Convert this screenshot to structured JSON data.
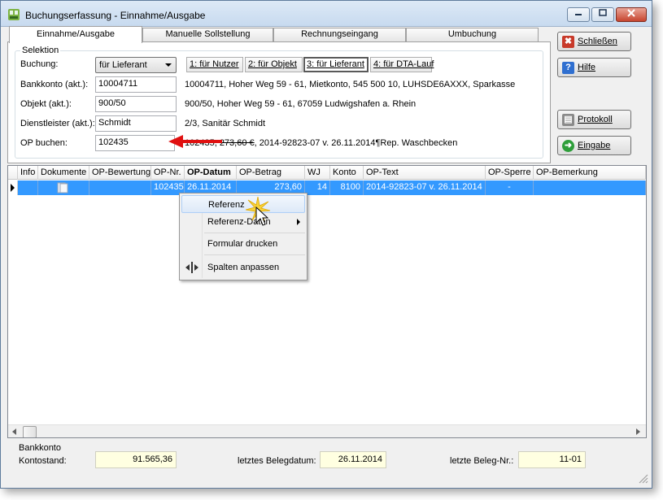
{
  "window": {
    "title": "Buchungserfassung - Einnahme/Ausgabe"
  },
  "tabs": [
    "Einnahme/Ausgabe",
    "Manuelle Sollstellung",
    "Rechnungseingang",
    "Umbuchung"
  ],
  "selektion": {
    "group_label": "Selektion",
    "buchung_label": "Buchung:",
    "buchung_value": "für Lieferant",
    "select_buttons": [
      "1: für Nutzer",
      "2: für Objekt",
      "3: für Lieferant",
      "4: für DTA-Lauf"
    ],
    "bankkonto_label": "Bankkonto (akt.):",
    "bankkonto_value": "10004711",
    "bankkonto_info": "10004711,  Hoher Weg 59 - 61,  Mietkonto,  545 500 10,  LUHSDE6AXXX,  Sparkasse",
    "objekt_label": "Objekt (akt.):",
    "objekt_value": "900/50",
    "objekt_info": "900/50,  Hoher Weg 59 - 61, 67059 Ludwigshafen a. Rhein",
    "dienstleister_label": "Dienstleister (akt.):",
    "dienstleister_value": "Schmidt",
    "dienstleister_info": "2/3,  Sanitär Schmidt",
    "op_label": "OP buchen:",
    "op_value": "102435",
    "op_info_struck": "102435,  273,60 €",
    "op_info_rest": ",  2014-92823-07 v. 26.11.2014¶Rep. Waschbecken"
  },
  "buttons": {
    "schliessen": "Schließen",
    "hilfe": "Hilfe",
    "protokoll": "Protokoll",
    "eingabe": "Eingabe"
  },
  "grid": {
    "columns": [
      "Info",
      "Dokumente",
      "OP-Bewertung",
      "OP-Nr.",
      "OP-Datum",
      "OP-Betrag",
      "WJ",
      "Konto",
      "OP-Text",
      "OP-Sperre",
      "OP-Bemerkung"
    ],
    "row": {
      "op_nr": "102435",
      "op_datum": "26.11.2014",
      "op_betrag": "273,60",
      "wj": "14",
      "konto": "8100",
      "op_text": "2014-92823-07 v. 26.11.2014",
      "op_sperre": "-"
    }
  },
  "context_menu": [
    "Referenz",
    "Referenz-Daten",
    "Formular drucken",
    "Spalten anpassen"
  ],
  "footer": {
    "group_label": "Bankkonto",
    "kontostand_label": "Kontostand:",
    "kontostand_value": "91.565,36",
    "belegdatum_label": "letztes Belegdatum:",
    "belegdatum_value": "26.11.2014",
    "belegnr_label": "letzte Beleg-Nr.:",
    "belegnr_value": "11-01"
  },
  "colors": {
    "selection": "#3399ff",
    "arrow": "#e01010",
    "info_field": "#ffffe1",
    "close_button": "#c7452f"
  }
}
